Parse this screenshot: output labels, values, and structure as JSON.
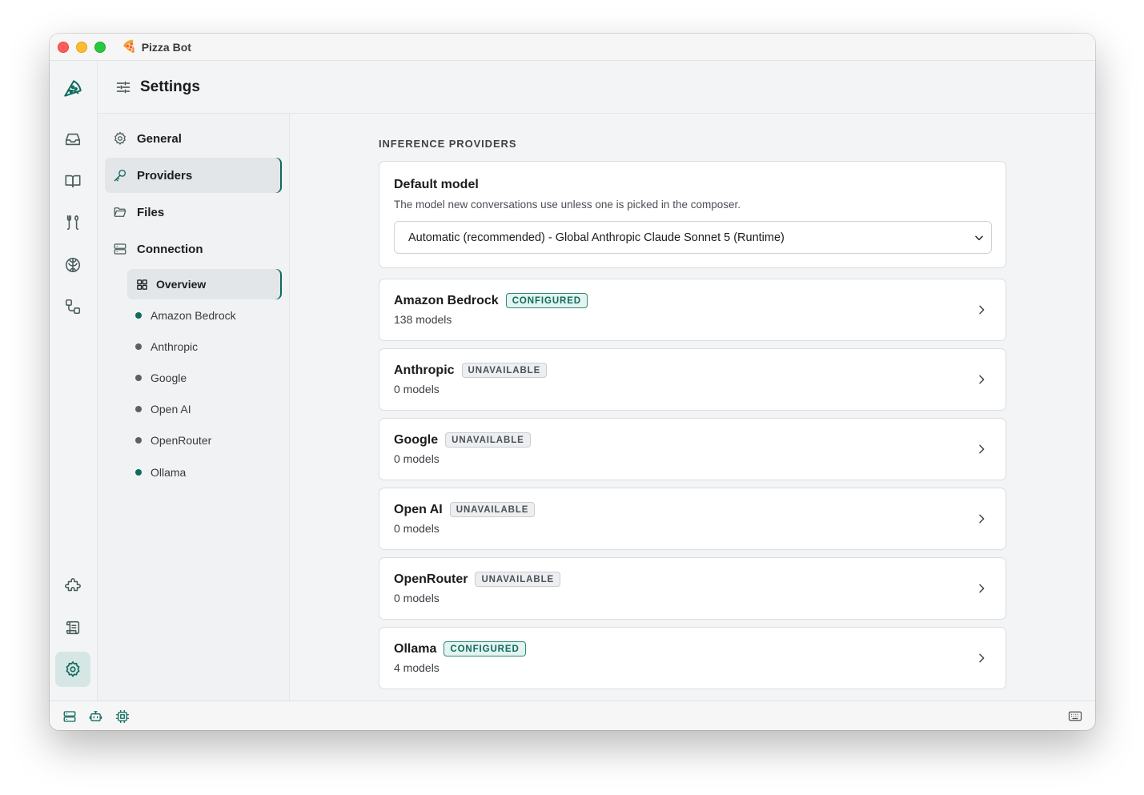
{
  "window": {
    "app_emoji": "🍕",
    "title": "Pizza Bot"
  },
  "rail": {
    "items": [
      {
        "icon": "pizza-logo-icon"
      },
      {
        "icon": "inbox-icon"
      },
      {
        "icon": "book-icon"
      },
      {
        "icon": "tools-icon"
      },
      {
        "icon": "brain-icon"
      },
      {
        "icon": "workflow-icon"
      },
      {
        "icon": "puzzle-icon"
      },
      {
        "icon": "scroll-icon"
      },
      {
        "icon": "gear-icon",
        "active": true
      }
    ]
  },
  "header": {
    "icon": "sliders-icon",
    "title": "Settings"
  },
  "nav": {
    "general": "General",
    "providers": "Providers",
    "files": "Files",
    "connection": "Connection",
    "overview": "Overview",
    "providers_list": [
      {
        "label": "Amazon Bedrock",
        "status": "configured"
      },
      {
        "label": "Anthropic",
        "status": "unavailable"
      },
      {
        "label": "Google",
        "status": "unavailable"
      },
      {
        "label": "Open AI",
        "status": "unavailable"
      },
      {
        "label": "OpenRouter",
        "status": "unavailable"
      },
      {
        "label": "Ollama",
        "status": "configured"
      }
    ]
  },
  "main": {
    "section_label": "INFERENCE PROVIDERS",
    "default_model": {
      "title": "Default model",
      "description": "The model new conversations use unless one is picked in the composer.",
      "selected": "Automatic (recommended) - Global Anthropic Claude Sonnet 5 (Runtime)"
    },
    "providers": [
      {
        "name": "Amazon Bedrock",
        "badge": "CONFIGURED",
        "count": "138 models"
      },
      {
        "name": "Anthropic",
        "badge": "UNAVAILABLE",
        "count": "0 models"
      },
      {
        "name": "Google",
        "badge": "UNAVAILABLE",
        "count": "0 models"
      },
      {
        "name": "Open AI",
        "badge": "UNAVAILABLE",
        "count": "0 models"
      },
      {
        "name": "OpenRouter",
        "badge": "UNAVAILABLE",
        "count": "0 models"
      },
      {
        "name": "Ollama",
        "badge": "CONFIGURED",
        "count": "4 models"
      }
    ]
  },
  "statusbar": {
    "icons": [
      "server-icon",
      "bot-icon",
      "chip-icon",
      "keyboard-icon"
    ]
  },
  "colors": {
    "accent": "#0e6b5e",
    "badge_configured_bg": "#e3f3ef",
    "badge_unavailable_bg": "#eceef0"
  }
}
